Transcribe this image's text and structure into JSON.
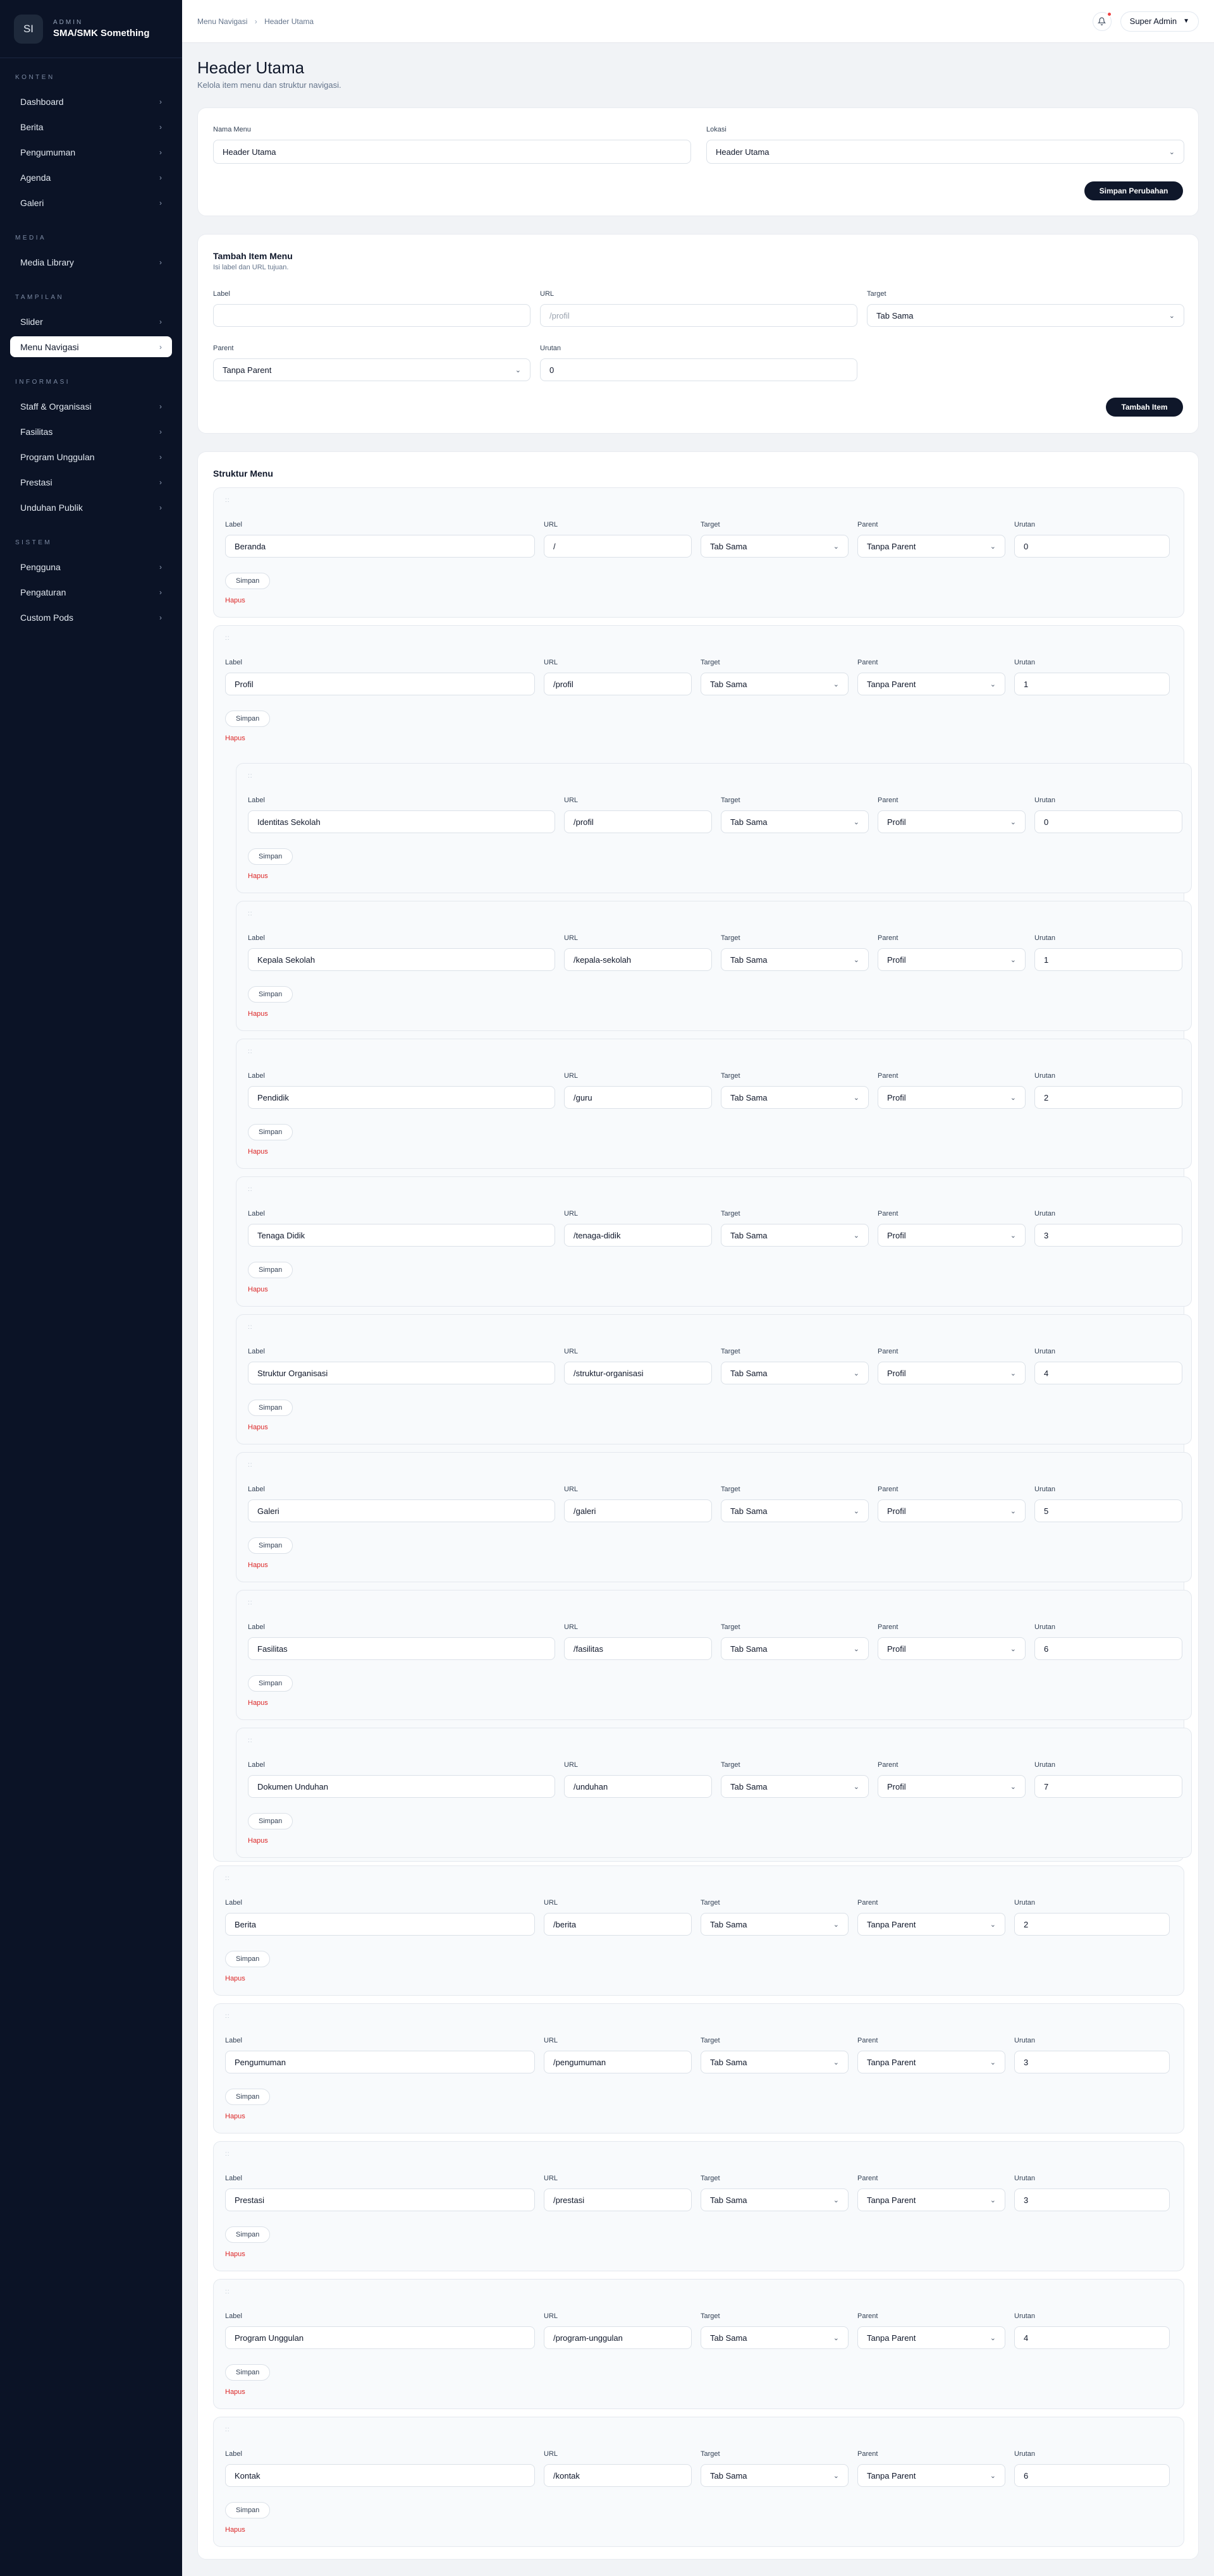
{
  "brand": {
    "initials": "SI",
    "role": "ADMIN",
    "name": "SMA/SMK Something"
  },
  "sidebar": {
    "sections": [
      {
        "title": "KONTEN",
        "items": [
          {
            "label": "Dashboard"
          },
          {
            "label": "Berita"
          },
          {
            "label": "Pengumuman"
          },
          {
            "label": "Agenda"
          },
          {
            "label": "Galeri"
          }
        ]
      },
      {
        "title": "MEDIA",
        "items": [
          {
            "label": "Media Library"
          }
        ]
      },
      {
        "title": "TAMPILAN",
        "items": [
          {
            "label": "Slider"
          },
          {
            "label": "Menu Navigasi",
            "active": true
          }
        ]
      },
      {
        "title": "INFORMASI",
        "items": [
          {
            "label": "Staff & Organisasi"
          },
          {
            "label": "Fasilitas"
          },
          {
            "label": "Program Unggulan"
          },
          {
            "label": "Prestasi"
          },
          {
            "label": "Unduhan Publik"
          }
        ]
      },
      {
        "title": "SISTEM",
        "items": [
          {
            "label": "Pengguna"
          },
          {
            "label": "Pengaturan"
          },
          {
            "label": "Custom Pods"
          }
        ]
      }
    ]
  },
  "topbar": {
    "breadcrumb": [
      "Menu Navigasi",
      "Header Utama"
    ],
    "user": "Super Admin"
  },
  "page": {
    "title": "Header Utama",
    "subtitle": "Kelola item menu dan struktur navigasi."
  },
  "settings": {
    "name_label": "Nama Menu",
    "name_value": "Header Utama",
    "location_label": "Lokasi",
    "location_value": "Header Utama",
    "save_label": "Simpan Perubahan"
  },
  "add_item": {
    "title": "Tambah Item Menu",
    "subtitle": "Isi label dan URL tujuan.",
    "label_label": "Label",
    "label_value": "",
    "url_label": "URL",
    "url_placeholder": "/profil",
    "target_label": "Target",
    "target_value": "Tab Sama",
    "parent_label": "Parent",
    "parent_value": "Tanpa Parent",
    "order_label": "Urutan",
    "order_value": "0",
    "add_label": "Tambah Item"
  },
  "structure": {
    "title": "Struktur Menu",
    "field_labels": {
      "label": "Label",
      "url": "URL",
      "target": "Target",
      "parent": "Parent",
      "order": "Urutan"
    },
    "save_label": "Simpan",
    "delete_label": "Hapus",
    "grip": "::",
    "items": [
      {
        "label": "Beranda",
        "url": "/",
        "target": "Tab Sama",
        "parent": "Tanpa Parent",
        "order": "0",
        "level": 0
      },
      {
        "label": "Profil",
        "url": "/profil",
        "target": "Tab Sama",
        "parent": "Tanpa Parent",
        "order": "1",
        "level": 0,
        "children": [
          {
            "label": "Identitas Sekolah",
            "url": "/profil",
            "target": "Tab Sama",
            "parent": "Profil",
            "order": "0",
            "level": 1
          },
          {
            "label": "Kepala Sekolah",
            "url": "/kepala-sekolah",
            "target": "Tab Sama",
            "parent": "Profil",
            "order": "1",
            "level": 1
          },
          {
            "label": "Pendidik",
            "url": "/guru",
            "target": "Tab Sama",
            "parent": "Profil",
            "order": "2",
            "level": 1
          },
          {
            "label": "Tenaga Didik",
            "url": "/tenaga-didik",
            "target": "Tab Sama",
            "parent": "Profil",
            "order": "3",
            "level": 1
          },
          {
            "label": "Struktur Organisasi",
            "url": "/struktur-organisasi",
            "target": "Tab Sama",
            "parent": "Profil",
            "order": "4",
            "level": 1
          },
          {
            "label": "Galeri",
            "url": "/galeri",
            "target": "Tab Sama",
            "parent": "Profil",
            "order": "5",
            "level": 1
          },
          {
            "label": "Fasilitas",
            "url": "/fasilitas",
            "target": "Tab Sama",
            "parent": "Profil",
            "order": "6",
            "level": 1
          },
          {
            "label": "Dokumen Unduhan",
            "url": "/unduhan",
            "target": "Tab Sama",
            "parent": "Profil",
            "order": "7",
            "level": 1
          }
        ]
      },
      {
        "label": "Berita",
        "url": "/berita",
        "target": "Tab Sama",
        "parent": "Tanpa Parent",
        "order": "2",
        "level": 0
      },
      {
        "label": "Pengumuman",
        "url": "/pengumuman",
        "target": "Tab Sama",
        "parent": "Tanpa Parent",
        "order": "3",
        "level": 0
      },
      {
        "label": "Prestasi",
        "url": "/prestasi",
        "target": "Tab Sama",
        "parent": "Tanpa Parent",
        "order": "3",
        "level": 0
      },
      {
        "label": "Program Unggulan",
        "url": "/program-unggulan",
        "target": "Tab Sama",
        "parent": "Tanpa Parent",
        "order": "4",
        "level": 0
      },
      {
        "label": "Kontak",
        "url": "/kontak",
        "target": "Tab Sama",
        "parent": "Tanpa Parent",
        "order": "6",
        "level": 0
      }
    ]
  }
}
